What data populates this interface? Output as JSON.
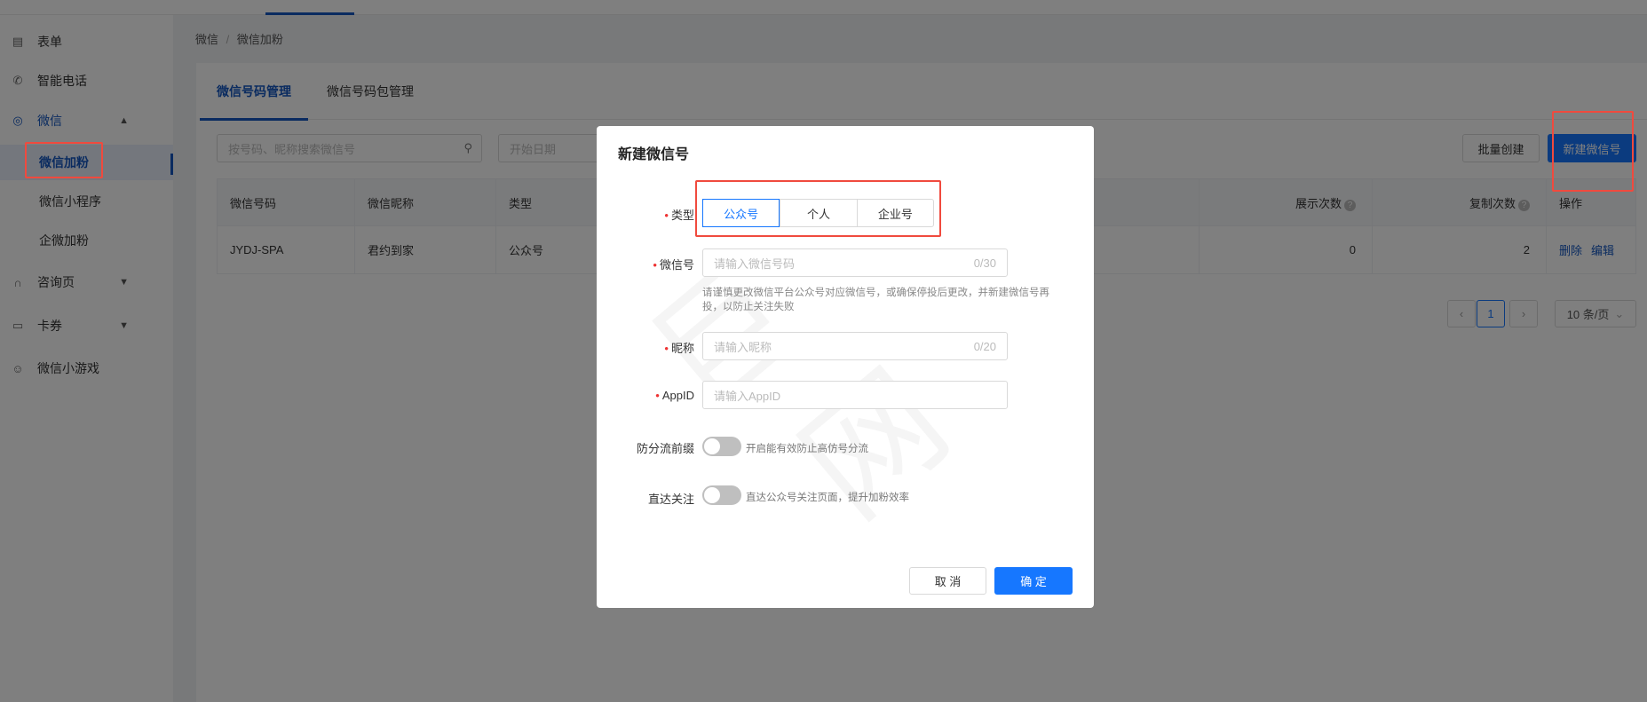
{
  "sidebar": {
    "items": [
      {
        "label": "表单",
        "icon": "form-icon"
      },
      {
        "label": "智能电话",
        "icon": "phone-icon"
      },
      {
        "label": "微信",
        "icon": "wechat-icon"
      },
      {
        "label": "微信加粉"
      },
      {
        "label": "微信小程序"
      },
      {
        "label": "企微加粉"
      },
      {
        "label": "咨询页",
        "icon": "headset-icon"
      },
      {
        "label": "卡券",
        "icon": "coupon-icon"
      },
      {
        "label": "微信小游戏",
        "icon": "game-icon"
      }
    ]
  },
  "breadcrumb": {
    "root": "微信",
    "sep": "/",
    "current": "微信加粉"
  },
  "tabs": [
    "微信号码管理",
    "微信号码包管理"
  ],
  "toolbar": {
    "search_placeholder": "按号码、昵称搜索微信号",
    "date_placeholder": "开始日期",
    "batch_create": "批量创建",
    "new_wechat": "新建微信号"
  },
  "table": {
    "headers": [
      "微信号码",
      "微信昵称",
      "类型",
      "展示次数",
      "复制次数",
      "操作"
    ],
    "rows": [
      {
        "code": "JYDJ-SPA",
        "nickname": "君约到家",
        "type": "公众号",
        "views": "0",
        "copies": "2",
        "delete": "删除",
        "edit": "编辑"
      }
    ]
  },
  "pagination": {
    "page": "1",
    "page_size": "10 条/页"
  },
  "dialog": {
    "title": "新建微信号",
    "type_label": "类型",
    "type_options": [
      "公众号",
      "个人",
      "企业号"
    ],
    "type_selected": "公众号",
    "wechat_label": "微信号",
    "wechat_placeholder": "请输入微信号码",
    "wechat_count": "0/30",
    "wechat_help": "请谨慎更改微信平台公众号对应微信号，或确保停投后更改，并新建微信号再投，以防止关注失败",
    "nick_label": "昵称",
    "nick_placeholder": "请输入昵称",
    "nick_count": "0/20",
    "appid_label": "AppID",
    "appid_placeholder": "请输入AppID",
    "prefix_label": "防分流前缀",
    "prefix_desc": "开启能有效防止高仿号分流",
    "prefix_on": false,
    "direct_label": "直达关注",
    "direct_desc": "直达公众号关注页面，提升加粉效率",
    "direct_on": false,
    "cancel": "取 消",
    "ok": "确 定"
  }
}
